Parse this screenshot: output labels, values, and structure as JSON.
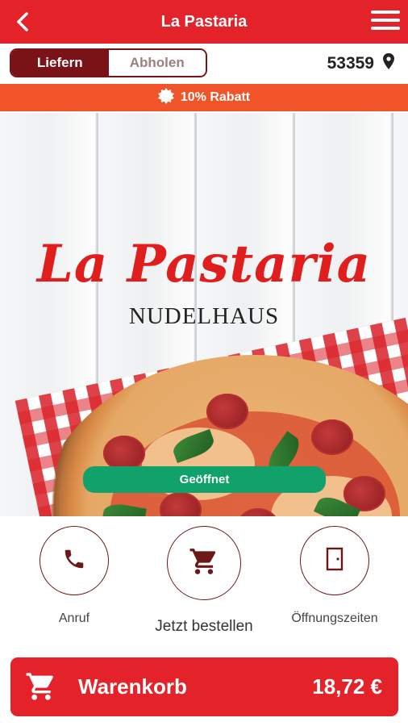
{
  "header": {
    "title": "La Pastaria",
    "back_icon": "chevron-left-icon",
    "menu_icon": "hamburger-menu-icon",
    "background_color": "#e4222a"
  },
  "mode_switch": {
    "options": [
      "Liefern",
      "Abholen"
    ],
    "selected": "Liefern",
    "accent_color": "#7a1318"
  },
  "location": {
    "zip": "53359",
    "icon": "location-pin-icon"
  },
  "promo": {
    "icon": "starburst-icon",
    "text": "10% Rabatt",
    "background_color": "#f2542a"
  },
  "hero": {
    "brand_name": "La Pastaria",
    "subtitle": "NUDELHAUS",
    "status": "Geöffnet",
    "status_color": "#11a26b"
  },
  "actions": [
    {
      "label": "Anruf",
      "icon": "phone-icon"
    },
    {
      "label": "Jetzt bestellen",
      "icon": "shopping-cart-icon"
    },
    {
      "label": "Öffnungszeiten",
      "icon": "door-icon"
    }
  ],
  "cart": {
    "label": "Warenkorb",
    "total": "18,72 €",
    "icon": "shopping-cart-icon"
  }
}
